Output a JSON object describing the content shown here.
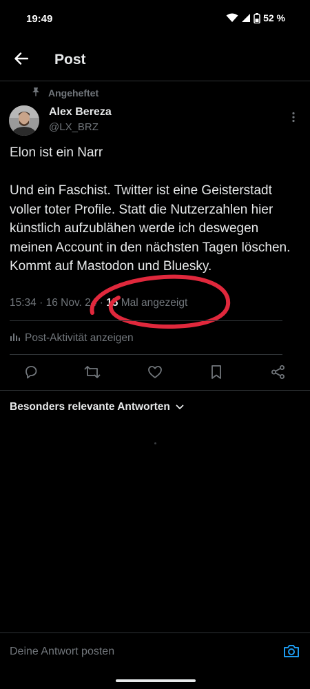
{
  "status_bar": {
    "time": "19:49",
    "battery": "52 %"
  },
  "header": {
    "title": "Post"
  },
  "post": {
    "pinned_label": "Angeheftet",
    "author": {
      "name": "Alex Bereza",
      "handle": "@LX_BRZ"
    },
    "paragraphs": [
      "Elon ist ein Narr",
      "Und ein Faschist. Twitter ist eine Geisterstadt voller toter Profile. Statt die Nutzerzahlen hier künstlich aufzublähen werde ich deswegen meinen Account in den nächsten Tagen löschen. Kommt auf Mastodon und Bluesky."
    ],
    "meta": {
      "time": "15:34",
      "date": "16 Nov. 24",
      "views_count": "15",
      "views_label": "Mal angezeigt"
    },
    "activity_label": "Post-Aktivität anzeigen"
  },
  "replies": {
    "sort_label": "Besonders relevante Antworten"
  },
  "reply_bar": {
    "placeholder": "Deine Antwort posten"
  },
  "colors": {
    "background": "#000000",
    "text_primary": "#e7e9ea",
    "text_secondary": "#71767b",
    "accent": "#1d9bf0",
    "divider": "#2f3336",
    "annotation": "#e0283c"
  }
}
